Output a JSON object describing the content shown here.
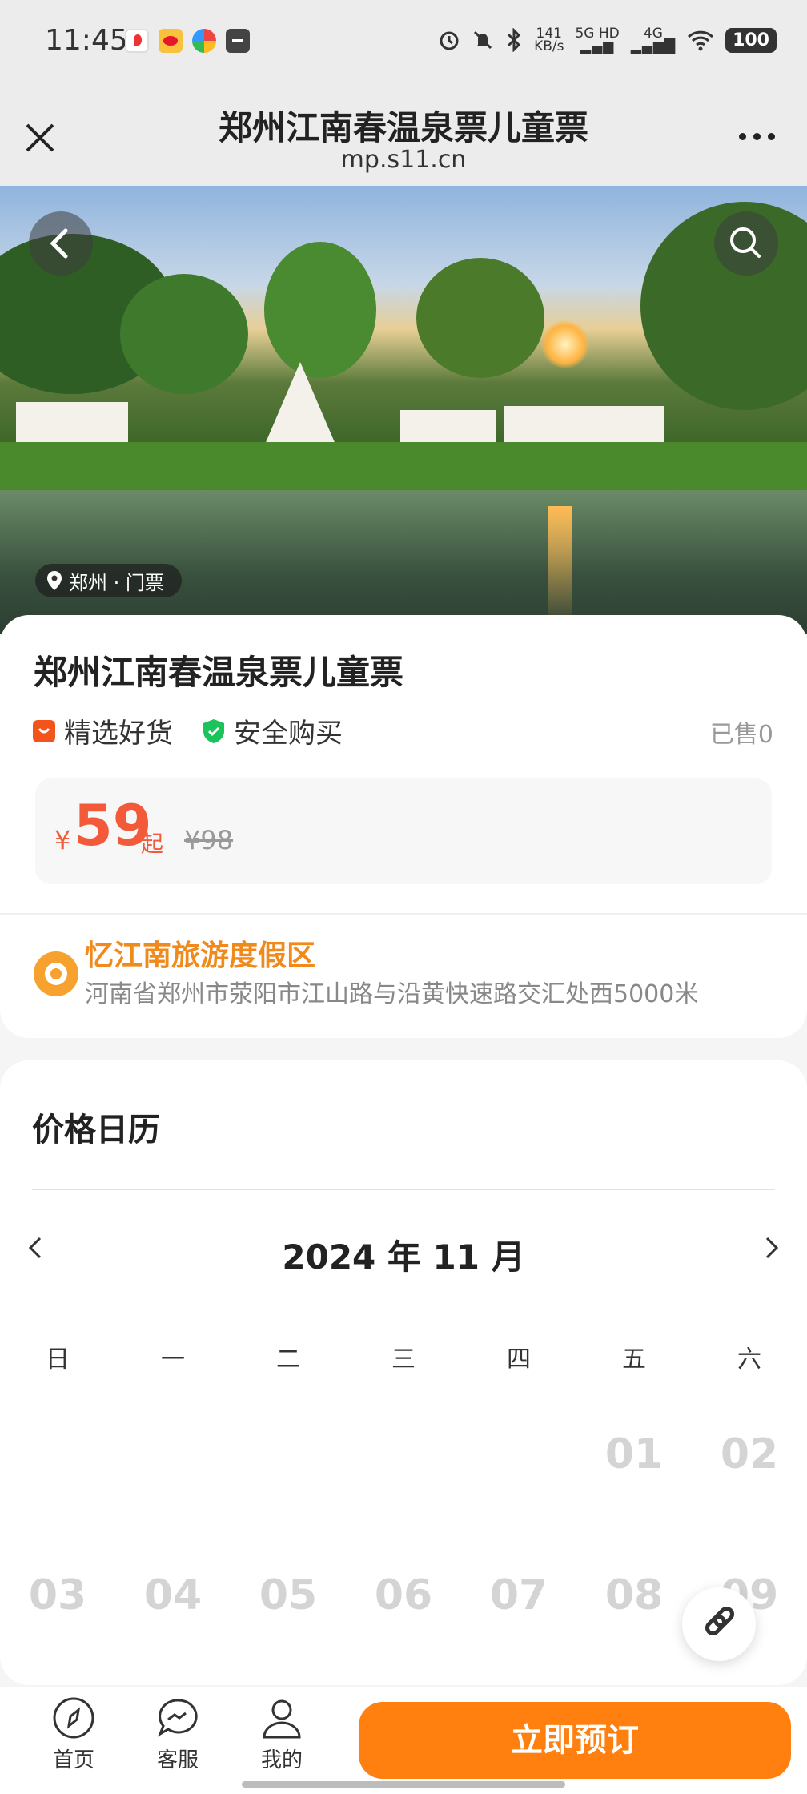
{
  "status_bar": {
    "time": "11:45",
    "net_speed_value": "141",
    "net_speed_unit": "KB/s",
    "signal_label": "5G HD",
    "signal_label2": "4G",
    "battery": "100"
  },
  "header": {
    "title": "郑州江南春温泉票儿童票",
    "url": "mp.s11.cn"
  },
  "hero": {
    "location_tag": "郑州 · 门票"
  },
  "product": {
    "title": "郑州江南春温泉票儿童票",
    "tag1": "精选好货",
    "tag2": "安全购买",
    "sold": "已售0",
    "currency": "¥",
    "price": "59",
    "price_suffix": "起",
    "original_price": "¥98"
  },
  "location": {
    "name": "忆江南旅游度假区",
    "address": "河南省郑州市荥阳市江山路与沿黄快速路交汇处西5000米"
  },
  "calendar": {
    "title": "价格日历",
    "month": "2024 年 11 月",
    "weekdays": [
      "日",
      "一",
      "二",
      "三",
      "四",
      "五",
      "六"
    ],
    "days": [
      "",
      "",
      "",
      "",
      "",
      "01",
      "02",
      "03",
      "04",
      "05",
      "06",
      "07",
      "08",
      "09"
    ]
  },
  "bottom_nav": {
    "home": "首页",
    "service": "客服",
    "mine": "我的",
    "book": "立即预订"
  },
  "colors": {
    "accent": "#ff7f0f",
    "price": "#f25a3a",
    "location": "#f08a1c"
  }
}
